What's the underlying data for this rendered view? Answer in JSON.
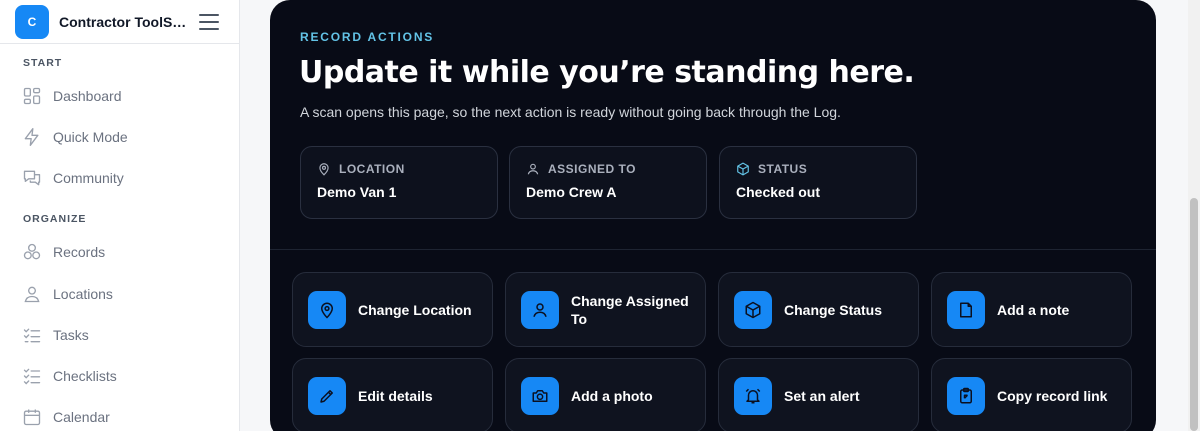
{
  "sidebar": {
    "brand_initial": "C",
    "brand_name": "Contractor ToolS…",
    "sections": [
      {
        "title": "START",
        "items": [
          {
            "label": "Dashboard",
            "icon": "dashboard-icon"
          },
          {
            "label": "Quick Mode",
            "icon": "lightning-icon"
          },
          {
            "label": "Community",
            "icon": "chat-icon"
          }
        ]
      },
      {
        "title": "ORGANIZE",
        "items": [
          {
            "label": "Records",
            "icon": "boxes-icon"
          },
          {
            "label": "Locations",
            "icon": "location-person-icon"
          },
          {
            "label": "Tasks",
            "icon": "tasks-icon"
          },
          {
            "label": "Checklists",
            "icon": "checklist-icon"
          },
          {
            "label": "Calendar",
            "icon": "calendar-icon"
          }
        ]
      }
    ]
  },
  "main": {
    "eyebrow": "RECORD ACTIONS",
    "headline": "Update it while you’re standing here.",
    "subtext": "A scan opens this page, so the next action is ready without going back through the Log.",
    "info_cards": [
      {
        "label": "LOCATION",
        "value": "Demo Van 1",
        "icon": "map-pin-icon"
      },
      {
        "label": "ASSIGNED TO",
        "value": "Demo Crew A",
        "icon": "user-icon"
      },
      {
        "label": "STATUS",
        "value": "Checked out",
        "icon": "box-icon"
      }
    ],
    "actions": [
      {
        "label": "Change Location",
        "icon": "map-pin-icon"
      },
      {
        "label": "Change Assigned To",
        "icon": "user-icon"
      },
      {
        "label": "Change Status",
        "icon": "box-icon"
      },
      {
        "label": "Add a note",
        "icon": "note-icon"
      },
      {
        "label": "Edit details",
        "icon": "pencil-icon"
      },
      {
        "label": "Add a photo",
        "icon": "camera-icon"
      },
      {
        "label": "Set an alert",
        "icon": "alarm-icon"
      },
      {
        "label": "Copy record link",
        "icon": "clipboard-icon"
      }
    ]
  },
  "colors": {
    "accent": "#1688f5",
    "panel_bg": "#080b16",
    "eyebrow": "#63c3e6"
  }
}
